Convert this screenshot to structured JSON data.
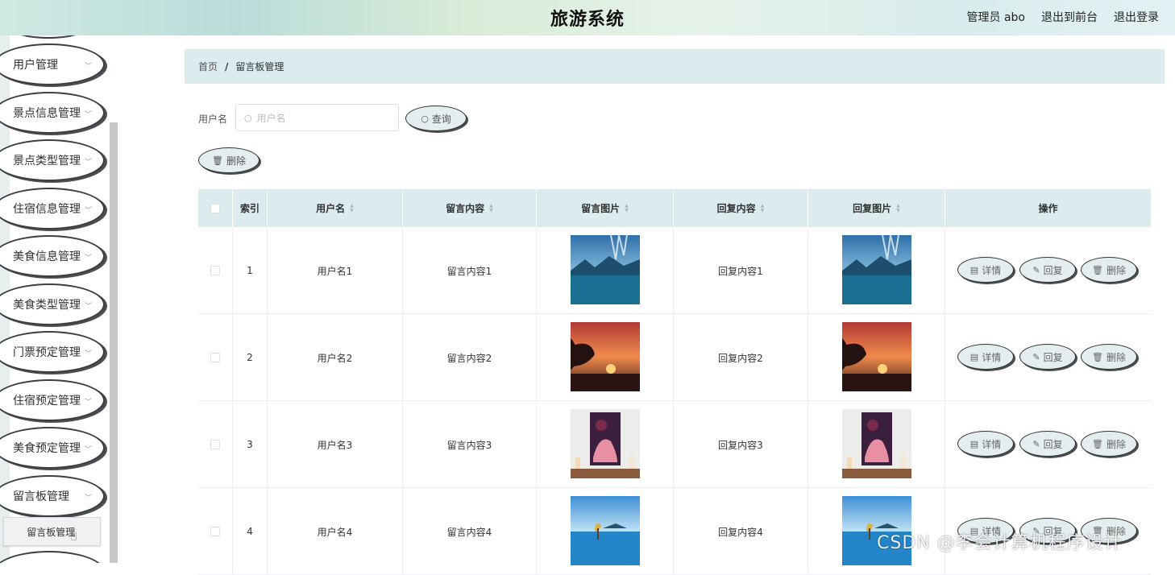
{
  "header": {
    "title": "旅游系统",
    "user": "管理员 abo",
    "to_front": "退出到前台",
    "logout": "退出登录"
  },
  "sidebar": {
    "items": [
      {
        "label": "用户管理"
      },
      {
        "label": "景点信息管理"
      },
      {
        "label": "景点类型管理"
      },
      {
        "label": "住宿信息管理"
      },
      {
        "label": "美食信息管理"
      },
      {
        "label": "美食类型管理"
      },
      {
        "label": "门票预定管理"
      },
      {
        "label": "住宿预定管理"
      },
      {
        "label": "美食预定管理"
      },
      {
        "label": "留言板管理"
      }
    ],
    "active_sub": "留言板管理"
  },
  "breadcrumb": {
    "home": "首页",
    "sep": "/",
    "current": "留言板管理"
  },
  "search": {
    "label": "用户名",
    "placeholder": "用户名",
    "button": "查询"
  },
  "toolbar": {
    "delete": "删除"
  },
  "table": {
    "headers": {
      "index": "索引",
      "username": "用户名",
      "content": "留言内容",
      "image": "留言图片",
      "reply": "回复内容",
      "reply_image": "回复图片",
      "ops": "操作"
    },
    "actions": {
      "detail": "详情",
      "reply": "回复",
      "delete": "删除"
    },
    "rows": [
      {
        "index": "1",
        "username": "用户名1",
        "content": "留言内容1",
        "reply": "回复内容1",
        "image": "lake-mountains"
      },
      {
        "index": "2",
        "username": "用户名2",
        "content": "留言内容2",
        "reply": "回复内容2",
        "image": "sunset-tree"
      },
      {
        "index": "3",
        "username": "用户名3",
        "content": "留言内容3",
        "reply": "回复内容3",
        "image": "pink-painting"
      },
      {
        "index": "4",
        "username": "用户名4",
        "content": "留言内容4",
        "reply": "回复内容4",
        "image": "blue-lake-tree"
      }
    ]
  },
  "watermark": "CSDN @李会计算机程序设计",
  "colors": {
    "header_bg": "#dcebed",
    "pill_bg": "#e4eeef"
  }
}
